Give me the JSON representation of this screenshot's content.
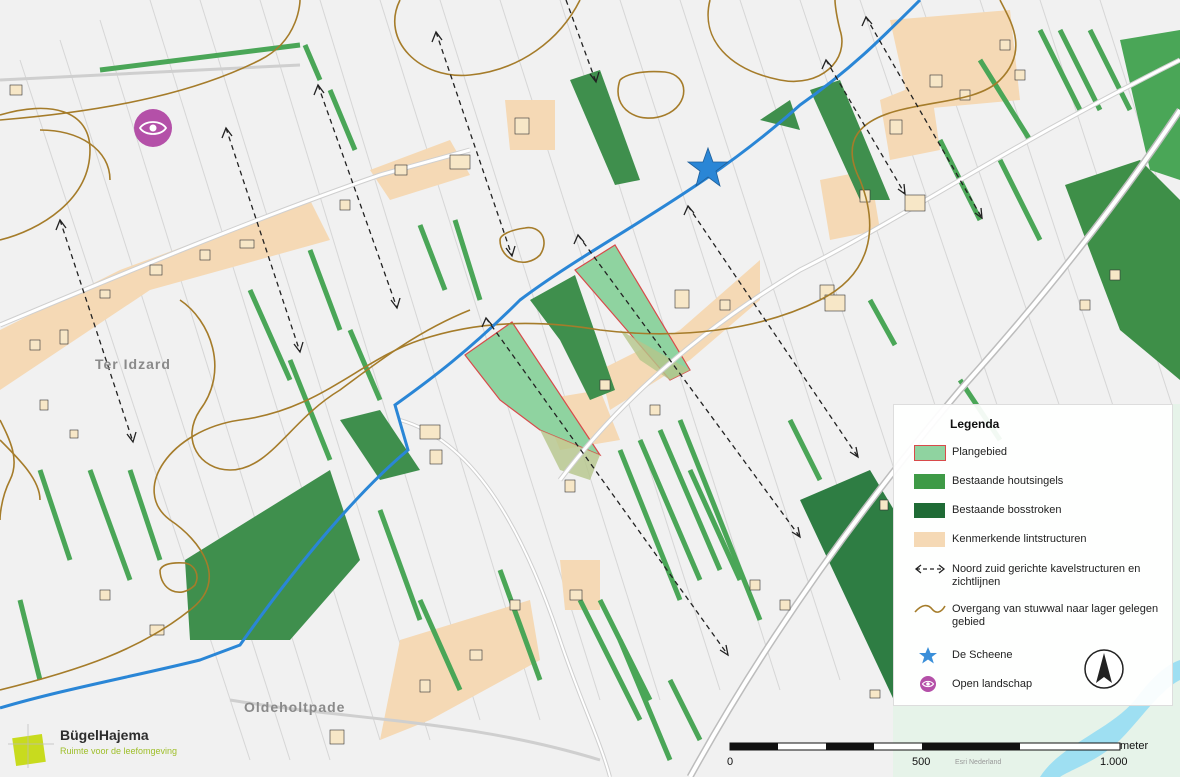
{
  "places": {
    "ter_idzard": "Ter Idzard",
    "oldeholtpade": "Oldeholtpade"
  },
  "legend": {
    "title": "Legenda",
    "items": [
      {
        "label": "Plangebied",
        "color": "#8fd3a0",
        "border": "#d84a4a"
      },
      {
        "label": "Bestaande houtsingels",
        "color": "#3e9a46"
      },
      {
        "label": "Bestaande bosstroken",
        "color": "#1f6b35"
      },
      {
        "label": "Kenmerkende lintstructuren",
        "color": "#f5d9b5"
      },
      {
        "label": "Noord zuid gerichte kavelstructuren en zichtlijnen",
        "icon": "double-dashed-arrow-icon"
      },
      {
        "label": "Overgang van stuwwal naar lager gelegen gebied",
        "color": "#a57c2a",
        "icon": "brown-line-icon"
      },
      {
        "label": "De Scheene",
        "color": "#3a8fd9",
        "icon": "blue-star-icon"
      },
      {
        "label": "Open landschap",
        "color": "#b450a8",
        "icon": "eye-icon"
      }
    ]
  },
  "scale": {
    "ticks": [
      "0",
      "500",
      "1.000"
    ],
    "unit": "meter"
  },
  "logo": {
    "name": "BügelHajema",
    "tagline": "Ruimte voor de leefomgeving"
  },
  "credit": "Esri Nederland",
  "colors": {
    "plangebied": "#8fd3a0",
    "houtsingel": "#4aa657",
    "bosstrook": "#2e7d43",
    "lint": "#f5d9b5",
    "scheene": "#2a86d6",
    "stuwwal": "#a57c2a",
    "open_landschap": "#b450a8"
  },
  "icons": {
    "north_arrow": "north-arrow-icon"
  }
}
